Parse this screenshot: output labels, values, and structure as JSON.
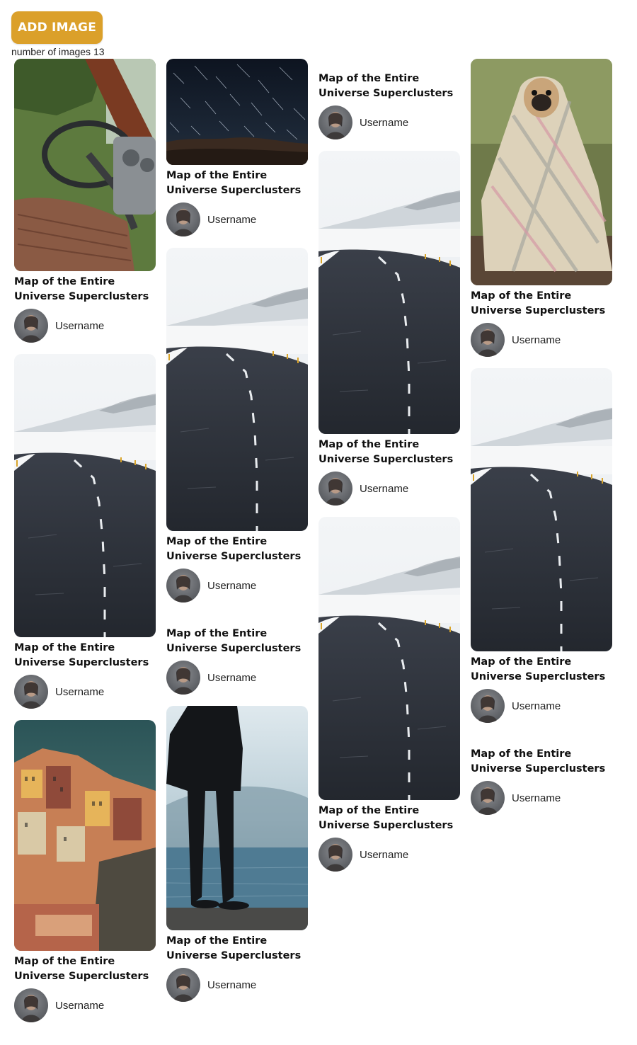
{
  "toolbar": {
    "add_label": "ADD IMAGE"
  },
  "counter": {
    "label": "number of images",
    "value": "13"
  },
  "colors": {
    "accent": "#dba02a"
  },
  "card": {
    "title_line1": "Map of the Entire",
    "title_line2": "Universe Superclusters",
    "username": "Username"
  },
  "columns": [
    [
      {
        "image": "vintage-car-interior"
      },
      {
        "image": "snowy-road"
      },
      {
        "image": "cliff-village"
      }
    ],
    [
      {
        "image": "star-trails"
      },
      {
        "image": "snowy-road"
      },
      {
        "image": "none"
      },
      {
        "image": "man-by-misty-lake"
      }
    ],
    [
      {
        "image": "none"
      },
      {
        "image": "snowy-road"
      },
      {
        "image": "snowy-road"
      }
    ],
    [
      {
        "image": "pug-in-blanket"
      },
      {
        "image": "snowy-road"
      },
      {
        "image": "none"
      }
    ]
  ]
}
